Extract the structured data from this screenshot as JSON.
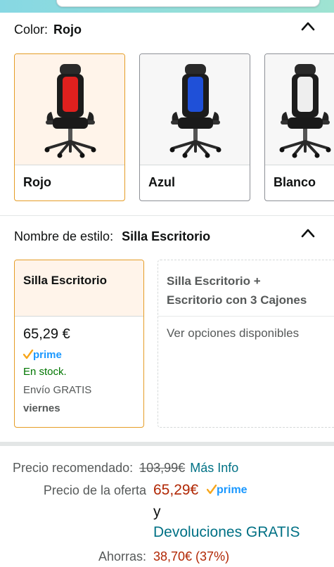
{
  "color_section": {
    "label": "Color:",
    "selected": "Rojo",
    "chevron_icon": "chevron-up-icon",
    "options": [
      {
        "label": "Rojo",
        "seat_color": "#e0201e"
      },
      {
        "label": "Azul",
        "seat_color": "#1f50d8"
      },
      {
        "label": "Blanco",
        "seat_color": "#eeeeee"
      }
    ]
  },
  "style_section": {
    "label": "Nombre de estilo:",
    "selected": "Silla Escritorio",
    "chevron_icon": "chevron-up-icon",
    "options": [
      {
        "title": "Silla Escritorio",
        "price": "65,29 €",
        "prime": "prime",
        "stock": "En stock.",
        "shipping": "Envío GRATIS",
        "delivery_day": "viernes"
      },
      {
        "title_line1": "Silla Escritorio +",
        "title_line2": "Escritorio con 3 Cajones",
        "availability": "Ver opciones disponibles"
      }
    ]
  },
  "pricing": {
    "recommended_label": "Precio recomendado:",
    "recommended_price": "103,99€",
    "more_info": "Más Info",
    "offer_label": "Precio de la oferta",
    "offer_price": "65,29€",
    "prime": "prime",
    "and": "y",
    "returns": "Devoluciones GRATIS",
    "savings_label": "Ahorras:",
    "savings_value": "38,70€ (37%)"
  },
  "colors": {
    "accent_border": "#e59d26",
    "price_red": "#b12704",
    "link_teal": "#007185",
    "stock_green": "#007600",
    "prime_blue": "#1a98ff"
  }
}
